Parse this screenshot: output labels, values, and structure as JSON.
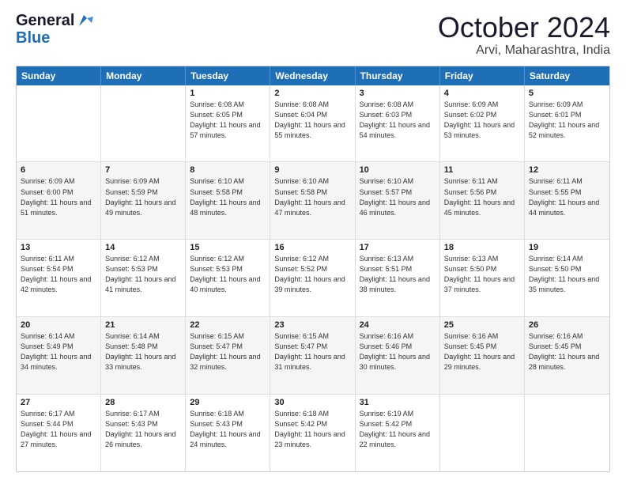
{
  "header": {
    "logo_line1": "General",
    "logo_line2": "Blue",
    "month": "October 2024",
    "location": "Arvi, Maharashtra, India"
  },
  "weekdays": [
    "Sunday",
    "Monday",
    "Tuesday",
    "Wednesday",
    "Thursday",
    "Friday",
    "Saturday"
  ],
  "rows": [
    [
      {
        "day": "",
        "info": ""
      },
      {
        "day": "",
        "info": ""
      },
      {
        "day": "1",
        "info": "Sunrise: 6:08 AM\nSunset: 6:05 PM\nDaylight: 11 hours and 57 minutes."
      },
      {
        "day": "2",
        "info": "Sunrise: 6:08 AM\nSunset: 6:04 PM\nDaylight: 11 hours and 55 minutes."
      },
      {
        "day": "3",
        "info": "Sunrise: 6:08 AM\nSunset: 6:03 PM\nDaylight: 11 hours and 54 minutes."
      },
      {
        "day": "4",
        "info": "Sunrise: 6:09 AM\nSunset: 6:02 PM\nDaylight: 11 hours and 53 minutes."
      },
      {
        "day": "5",
        "info": "Sunrise: 6:09 AM\nSunset: 6:01 PM\nDaylight: 11 hours and 52 minutes."
      }
    ],
    [
      {
        "day": "6",
        "info": "Sunrise: 6:09 AM\nSunset: 6:00 PM\nDaylight: 11 hours and 51 minutes."
      },
      {
        "day": "7",
        "info": "Sunrise: 6:09 AM\nSunset: 5:59 PM\nDaylight: 11 hours and 49 minutes."
      },
      {
        "day": "8",
        "info": "Sunrise: 6:10 AM\nSunset: 5:58 PM\nDaylight: 11 hours and 48 minutes."
      },
      {
        "day": "9",
        "info": "Sunrise: 6:10 AM\nSunset: 5:58 PM\nDaylight: 11 hours and 47 minutes."
      },
      {
        "day": "10",
        "info": "Sunrise: 6:10 AM\nSunset: 5:57 PM\nDaylight: 11 hours and 46 minutes."
      },
      {
        "day": "11",
        "info": "Sunrise: 6:11 AM\nSunset: 5:56 PM\nDaylight: 11 hours and 45 minutes."
      },
      {
        "day": "12",
        "info": "Sunrise: 6:11 AM\nSunset: 5:55 PM\nDaylight: 11 hours and 44 minutes."
      }
    ],
    [
      {
        "day": "13",
        "info": "Sunrise: 6:11 AM\nSunset: 5:54 PM\nDaylight: 11 hours and 42 minutes."
      },
      {
        "day": "14",
        "info": "Sunrise: 6:12 AM\nSunset: 5:53 PM\nDaylight: 11 hours and 41 minutes."
      },
      {
        "day": "15",
        "info": "Sunrise: 6:12 AM\nSunset: 5:53 PM\nDaylight: 11 hours and 40 minutes."
      },
      {
        "day": "16",
        "info": "Sunrise: 6:12 AM\nSunset: 5:52 PM\nDaylight: 11 hours and 39 minutes."
      },
      {
        "day": "17",
        "info": "Sunrise: 6:13 AM\nSunset: 5:51 PM\nDaylight: 11 hours and 38 minutes."
      },
      {
        "day": "18",
        "info": "Sunrise: 6:13 AM\nSunset: 5:50 PM\nDaylight: 11 hours and 37 minutes."
      },
      {
        "day": "19",
        "info": "Sunrise: 6:14 AM\nSunset: 5:50 PM\nDaylight: 11 hours and 35 minutes."
      }
    ],
    [
      {
        "day": "20",
        "info": "Sunrise: 6:14 AM\nSunset: 5:49 PM\nDaylight: 11 hours and 34 minutes."
      },
      {
        "day": "21",
        "info": "Sunrise: 6:14 AM\nSunset: 5:48 PM\nDaylight: 11 hours and 33 minutes."
      },
      {
        "day": "22",
        "info": "Sunrise: 6:15 AM\nSunset: 5:47 PM\nDaylight: 11 hours and 32 minutes."
      },
      {
        "day": "23",
        "info": "Sunrise: 6:15 AM\nSunset: 5:47 PM\nDaylight: 11 hours and 31 minutes."
      },
      {
        "day": "24",
        "info": "Sunrise: 6:16 AM\nSunset: 5:46 PM\nDaylight: 11 hours and 30 minutes."
      },
      {
        "day": "25",
        "info": "Sunrise: 6:16 AM\nSunset: 5:45 PM\nDaylight: 11 hours and 29 minutes."
      },
      {
        "day": "26",
        "info": "Sunrise: 6:16 AM\nSunset: 5:45 PM\nDaylight: 11 hours and 28 minutes."
      }
    ],
    [
      {
        "day": "27",
        "info": "Sunrise: 6:17 AM\nSunset: 5:44 PM\nDaylight: 11 hours and 27 minutes."
      },
      {
        "day": "28",
        "info": "Sunrise: 6:17 AM\nSunset: 5:43 PM\nDaylight: 11 hours and 26 minutes."
      },
      {
        "day": "29",
        "info": "Sunrise: 6:18 AM\nSunset: 5:43 PM\nDaylight: 11 hours and 24 minutes."
      },
      {
        "day": "30",
        "info": "Sunrise: 6:18 AM\nSunset: 5:42 PM\nDaylight: 11 hours and 23 minutes."
      },
      {
        "day": "31",
        "info": "Sunrise: 6:19 AM\nSunset: 5:42 PM\nDaylight: 11 hours and 22 minutes."
      },
      {
        "day": "",
        "info": ""
      },
      {
        "day": "",
        "info": ""
      }
    ]
  ]
}
